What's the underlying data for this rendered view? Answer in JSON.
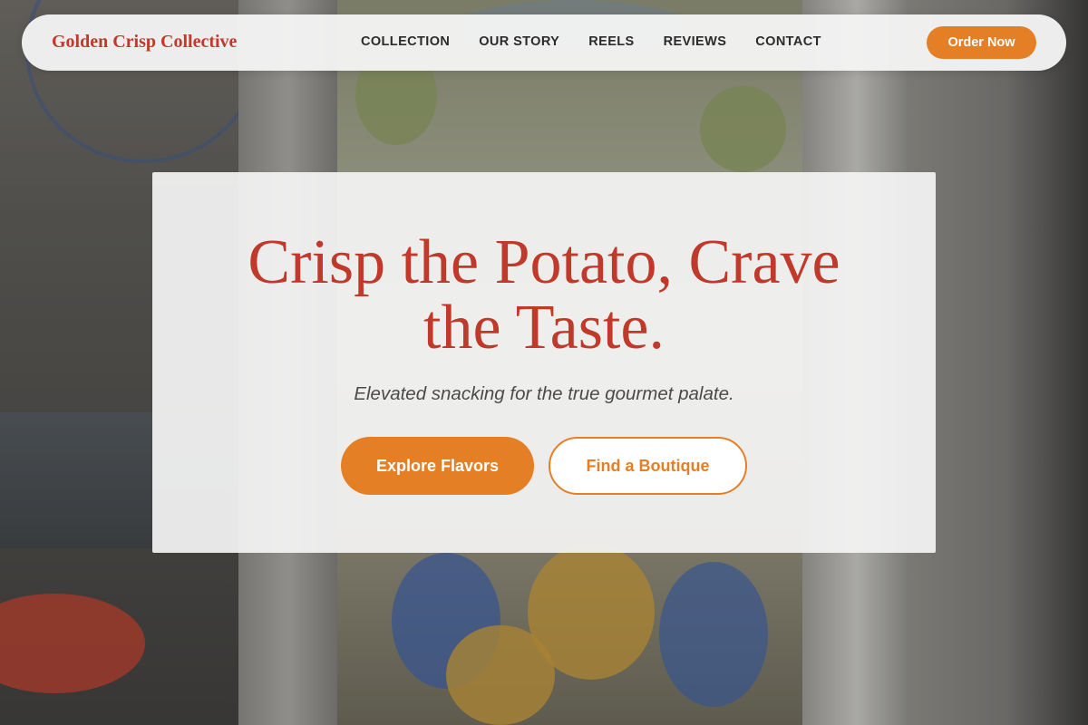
{
  "nav": {
    "brand": "Golden Crisp Collective",
    "links": [
      "COLLECTION",
      "OUR STORY",
      "REELS",
      "REVIEWS",
      "CONTACT"
    ],
    "cta_label": "Order Now"
  },
  "hero": {
    "title_line1": "Crisp the Potato, Crave",
    "title_line2": "the Taste.",
    "subtitle": "Elevated snacking for the true gourmet palate.",
    "primary_label": "Explore Flavors",
    "secondary_label": "Find a Boutique"
  },
  "colors": {
    "accent": "#e57f26",
    "brand_red": "#bf3a2c"
  }
}
